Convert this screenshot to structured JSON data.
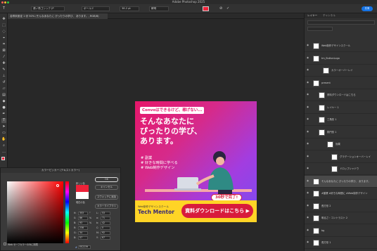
{
  "window": {
    "title": "Adobe Photoshop 2025"
  },
  "options_bar": {
    "font_family": "源ノ角ゴシック JP",
    "font_style": "ボールド",
    "font_size": "38.2 pt",
    "antialias": "鮮明",
    "share_label": "共有"
  },
  "document": {
    "tab_title": "名称未設定 1 @ 50% (そんなあなたに ぴったりの学び、 あります。, RGB/8)"
  },
  "artboard": {
    "catch": "Convoはできるけど、稼げない...",
    "headline": [
      "そんなあなたに",
      "ぴったりの学び、",
      "あります。"
    ],
    "bullets": [
      "# 副業",
      "# 好きな時間に学べる",
      "# Web制作デザイン"
    ],
    "badge": "30秒で完了!",
    "brand_small": "Web制作デザインスクール",
    "brand": "Tech Mentor",
    "cta": "資料ダウンロードはこちら ▶"
  },
  "picker": {
    "title": "カラーピッカー (テキストカラー)",
    "ok": "OK",
    "cancel": "キャンセル",
    "add_swatch": "スウォッチに追加",
    "libraries": "カラーライブラリ",
    "new_label": "新しい色",
    "current_label": "現在の色",
    "web_only": "Web セーフカラーのみに制限",
    "fields": [
      {
        "label": "H:",
        "value": "353",
        "unit": "°",
        "label2": "L:",
        "value2": "53"
      },
      {
        "label": "S:",
        "value": "86",
        "unit": "%",
        "label2": "a:",
        "value2": "71"
      },
      {
        "label": "B:",
        "value": "93",
        "unit": "%",
        "label2": "b:",
        "value2": "42"
      },
      {
        "label": "R:",
        "value": "238",
        "unit": "",
        "label2": "C:",
        "value2": "0"
      },
      {
        "label": "G:",
        "value": "34",
        "unit": "",
        "label2": "M:",
        "value2": "92"
      },
      {
        "label": "B:",
        "value": "57",
        "unit": "",
        "label2": "Y:",
        "value2": "67"
      }
    ],
    "hex": "EE2239",
    "colors": {
      "new": "#ee2239",
      "current": "#ffffff"
    }
  },
  "panels": {
    "tab_layers": "レイヤー",
    "tab_channels": "チャンネル",
    "layers": [
      "Web制作デザインスクール",
      "tm_ButtonLogo",
      "カラーオーバーレイ",
      "present",
      "資料ダウンロードはこちら",
      "レイヤー 1",
      "三角形 1",
      "楕円形 1",
      "効果",
      "グラデーションオーバーレイ",
      "ドロップシャドウ",
      "そんなあなたに ぴったりの学び、 あります。",
      "#副業 #好きな時間に #Web制作デザイン",
      "長方形 2",
      "明るさ・コントラスト 2",
      "bg",
      "長方形 1"
    ]
  }
}
